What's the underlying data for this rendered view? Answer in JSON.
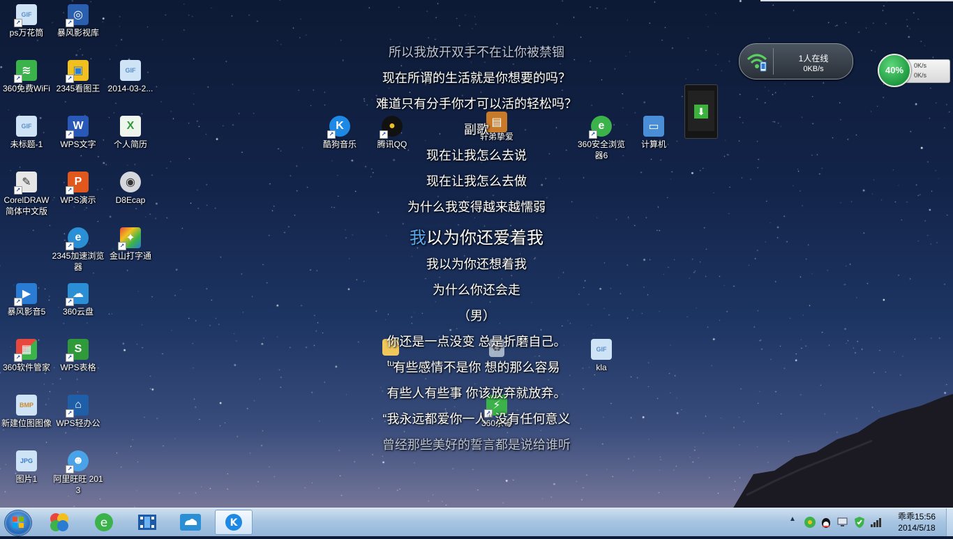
{
  "desktop_icons": [
    {
      "label": "ps万花筒",
      "icon": "gif-file-icon"
    },
    {
      "label": "暴风影视库",
      "icon": "baofeng-library-icon"
    },
    {
      "label": "360免费WiFi",
      "icon": "wifi-icon"
    },
    {
      "label": "2345看图王",
      "icon": "image-viewer-icon"
    },
    {
      "label": "2014-03-2...",
      "icon": "gif-file-icon"
    },
    {
      "label": "未标题-1",
      "icon": "gif-file-icon"
    },
    {
      "label": "WPS文字",
      "icon": "wps-writer-icon"
    },
    {
      "label": "个人简历",
      "icon": "spreadsheet-file-icon"
    },
    {
      "label": "CorelDRAW 简体中文版",
      "icon": "coreldraw-icon"
    },
    {
      "label": "WPS演示",
      "icon": "wps-presentation-icon"
    },
    {
      "label": "D8Ecap",
      "icon": "webcam-icon"
    },
    {
      "label": "2345加速浏览器",
      "icon": "browser-icon"
    },
    {
      "label": "金山打字通",
      "icon": "typing-icon"
    },
    {
      "label": "暴风影音5",
      "icon": "baofeng-player-icon"
    },
    {
      "label": "360云盘",
      "icon": "cloud-disk-icon"
    },
    {
      "label": "360软件管家",
      "icon": "software-manager-icon"
    },
    {
      "label": "WPS表格",
      "icon": "wps-spreadsheet-icon"
    },
    {
      "label": "新建位图图像",
      "icon": "bmp-file-icon"
    },
    {
      "label": "WPS轻办公",
      "icon": "wps-office-icon"
    },
    {
      "label": "图片1",
      "icon": "jpg-file-icon"
    },
    {
      "label": "阿里旺旺 2013",
      "icon": "aliwangwang-icon"
    },
    {
      "label": "酷狗音乐",
      "icon": "kugou-icon"
    },
    {
      "label": "腾讯QQ",
      "icon": "qq-penguin-icon"
    },
    {
      "label": "轩弟挚爱",
      "icon": "briefcase-icon"
    },
    {
      "label": "360安全浏览器6",
      "icon": "360-browser-icon"
    },
    {
      "label": "计算机",
      "icon": "computer-icon"
    },
    {
      "label": "tu",
      "icon": "folder-icon"
    },
    {
      "label": "kla",
      "icon": "gif-file-icon"
    },
    {
      "label": "360杀毒",
      "icon": "360-antivirus-icon"
    }
  ],
  "lyrics": {
    "l1": "所以我放开双手不在让你被禁锢",
    "l2": "现在所谓的生活就是你想要的吗？",
    "l3": "难道只有分手你才可以活的轻松吗？",
    "l4": "副歌",
    "l5": "现在让我怎么去说",
    "l6": "现在让我怎么去做",
    "l7": "为什么我变得越来越懦弱",
    "l8_highlight": "我",
    "l8_rest": "以为你还爱着我",
    "l9": "我以为你还想着我",
    "l10": "为什么你还会走",
    "l11": "（男）",
    "l12": "你还是一点没变 总是折磨自己。",
    "l13": "有些感情不是你 想的那么容易",
    "l14": "有些人有些事 你该放弃就放弃。",
    "l15": "“我永远都爱你一人” 没有任何意义",
    "l16": "曾经那些美好的誓言都是说给谁听"
  },
  "net_widget": {
    "users": "1人在线",
    "speed": "0KB/s"
  },
  "speed_ball": {
    "percent": "40%",
    "upload": "0K/s",
    "download": "0K/s"
  },
  "taskbar": {
    "start": "windows-start-icon",
    "pinned": [
      {
        "name": "360-security-icon"
      },
      {
        "name": "360-browser-icon"
      },
      {
        "name": "video-player-icon"
      },
      {
        "name": "cloud-disk-icon"
      },
      {
        "name": "kugou-icon",
        "active": true
      }
    ],
    "clock_time": "乖乖15:56",
    "clock_date": "2014/5/18"
  },
  "colors": {
    "lyric_highlight": "#5aa9ee",
    "taskbar": "#a9c6e2"
  }
}
